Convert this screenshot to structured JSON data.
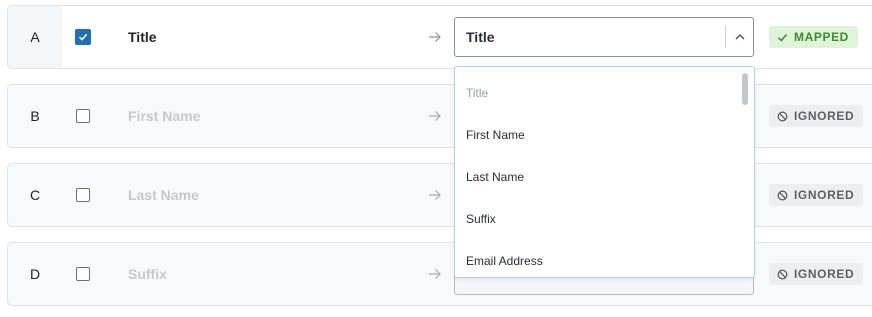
{
  "rows": [
    {
      "letter": "A",
      "column": "Title",
      "checked": true,
      "mapped_to": "Title",
      "status": "MAPPED"
    },
    {
      "letter": "B",
      "column": "First Name",
      "checked": false,
      "status": "IGNORED"
    },
    {
      "letter": "C",
      "column": "Last Name",
      "checked": false,
      "status": "IGNORED"
    },
    {
      "letter": "D",
      "column": "Suffix",
      "checked": false,
      "status": "IGNORED"
    }
  ],
  "dropdown": {
    "options": [
      "Title",
      "First Name",
      "Last Name",
      "Suffix",
      "Email Address"
    ],
    "selected": "Title"
  },
  "colors": {
    "checkbox_checked": "#1f6fb2",
    "mapped_bg": "#dff3d8",
    "mapped_text": "#3d8c35",
    "ignored_bg": "#eceef0",
    "ignored_text": "#5b6168",
    "dropdown_border": "#a9d6ec"
  },
  "icons": {
    "mapped": "check-icon",
    "ignored": "block-icon",
    "arrow": "arrow-right-icon",
    "chevron": "chevron-up-icon"
  }
}
